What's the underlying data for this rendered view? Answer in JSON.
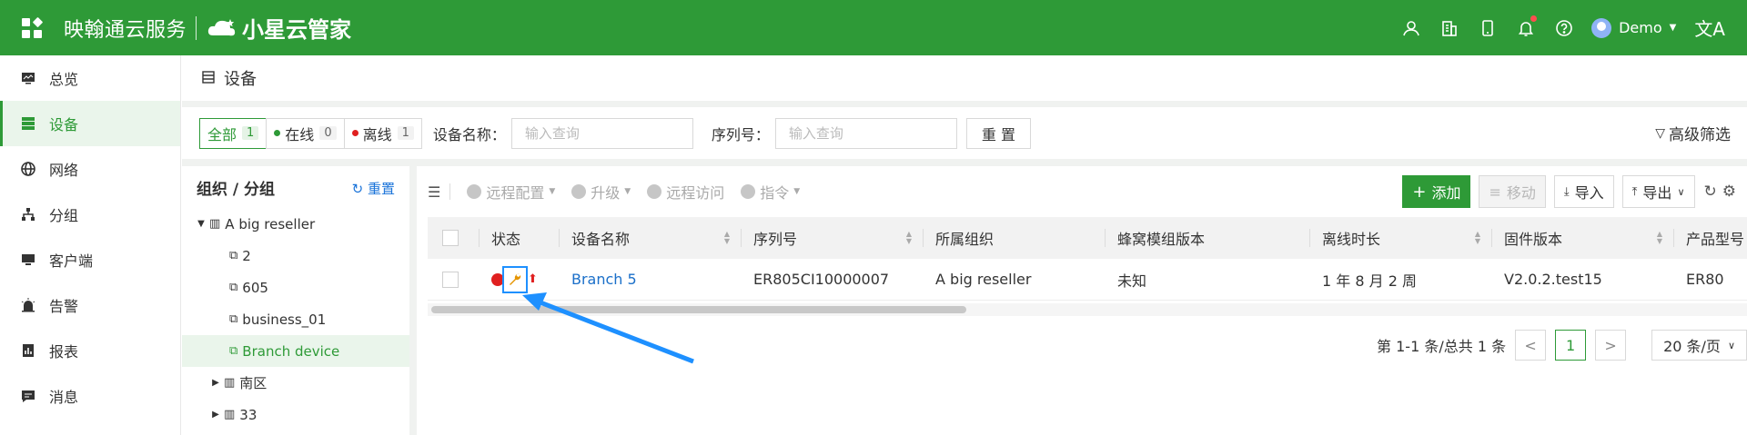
{
  "header": {
    "brand": "映翰通云服务",
    "product": "小星云管家",
    "user": "Demo",
    "lang_icon": "文A"
  },
  "sidebar": {
    "items": [
      {
        "label": "总览",
        "icon": "monitor-icon"
      },
      {
        "label": "设备",
        "icon": "device-list-icon"
      },
      {
        "label": "网络",
        "icon": "globe-icon"
      },
      {
        "label": "分组",
        "icon": "group-icon"
      },
      {
        "label": "客户端",
        "icon": "client-icon"
      },
      {
        "label": "告警",
        "icon": "alarm-icon"
      },
      {
        "label": "报表",
        "icon": "report-icon"
      },
      {
        "label": "消息",
        "icon": "message-icon"
      }
    ]
  },
  "page": {
    "title": "设备"
  },
  "filters": {
    "all_label": "全部",
    "all_count": "1",
    "online_label": "在线",
    "online_count": "0",
    "offline_label": "离线",
    "offline_count": "1",
    "name_label": "设备名称：",
    "name_placeholder": "输入查询",
    "serial_label": "序列号：",
    "serial_placeholder": "输入查询",
    "reset": "重 置",
    "advanced": "高级筛选"
  },
  "org": {
    "title": "组织 / 分组",
    "reset": "重置",
    "root": "A big reseller",
    "children": [
      "2",
      "605",
      "business_01",
      "Branch device"
    ],
    "siblings": [
      "南区",
      "33"
    ]
  },
  "toolbar": {
    "remote_config": "远程配置",
    "upgrade": "升级",
    "remote_access": "远程访问",
    "command": "指令",
    "add": "添加",
    "move": "移动",
    "import": "导入",
    "export": "导出"
  },
  "table": {
    "columns": [
      "状态",
      "设备名称",
      "序列号",
      "所属组织",
      "蜂窝模组版本",
      "离线时长",
      "固件版本",
      "产品型号"
    ],
    "rows": [
      {
        "name": "Branch 5",
        "serial": "ER805CI10000007",
        "org": "A big reseller",
        "module": "未知",
        "offline": "1 年 8 月 2 周",
        "firmware": "V2.0.2.test15",
        "model": "ER80"
      }
    ]
  },
  "pagination": {
    "summary": "第 1-1 条/总共 1 条",
    "current": "1",
    "page_size": "20 条/页"
  },
  "colors": {
    "brand_green": "#2e9a37",
    "link_blue": "#1a6fc9",
    "offline_red": "#e02020",
    "annotation_blue": "#1e90ff"
  }
}
